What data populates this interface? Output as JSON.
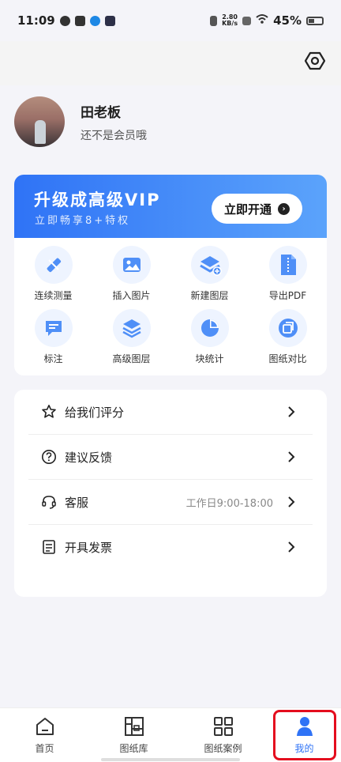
{
  "status_bar": {
    "time": "11:09",
    "network_speed_value": "2.80",
    "network_speed_unit": "KB/s",
    "battery": "45%"
  },
  "profile": {
    "name": "田老板",
    "membership": "还不是会员哦"
  },
  "vip": {
    "title": "升级成高级VIP",
    "subtitle": "立即畅享8+特权",
    "button": "立即开通"
  },
  "features": [
    {
      "label": "连续测量",
      "icon": "ruler-pencil-icon"
    },
    {
      "label": "插入图片",
      "icon": "image-icon"
    },
    {
      "label": "新建图层",
      "icon": "add-layer-icon"
    },
    {
      "label": "导出PDF",
      "icon": "pdf-file-icon"
    },
    {
      "label": "标注",
      "icon": "annotation-icon"
    },
    {
      "label": "高级图层",
      "icon": "layers-icon"
    },
    {
      "label": "块统计",
      "icon": "pie-chart-icon"
    },
    {
      "label": "图纸对比",
      "icon": "compare-icon"
    }
  ],
  "menu": [
    {
      "label": "给我们评分",
      "icon": "star-icon",
      "extra": ""
    },
    {
      "label": "建议反馈",
      "icon": "question-circle-icon",
      "extra": ""
    },
    {
      "label": "客服",
      "icon": "headset-icon",
      "extra": "工作日9:00-18:00"
    },
    {
      "label": "开具发票",
      "icon": "invoice-icon",
      "extra": ""
    }
  ],
  "bottom_nav": [
    {
      "label": "首页",
      "icon": "home-icon"
    },
    {
      "label": "图纸库",
      "icon": "drawing-library-icon"
    },
    {
      "label": "图纸案例",
      "icon": "grid-icon"
    },
    {
      "label": "我的",
      "icon": "person-icon"
    }
  ],
  "colors": {
    "accent": "#2F73F6",
    "vip_gradient_start": "#2F73F6",
    "vip_gradient_end": "#5BA3FB",
    "highlight_box": "#E40D1E"
  }
}
